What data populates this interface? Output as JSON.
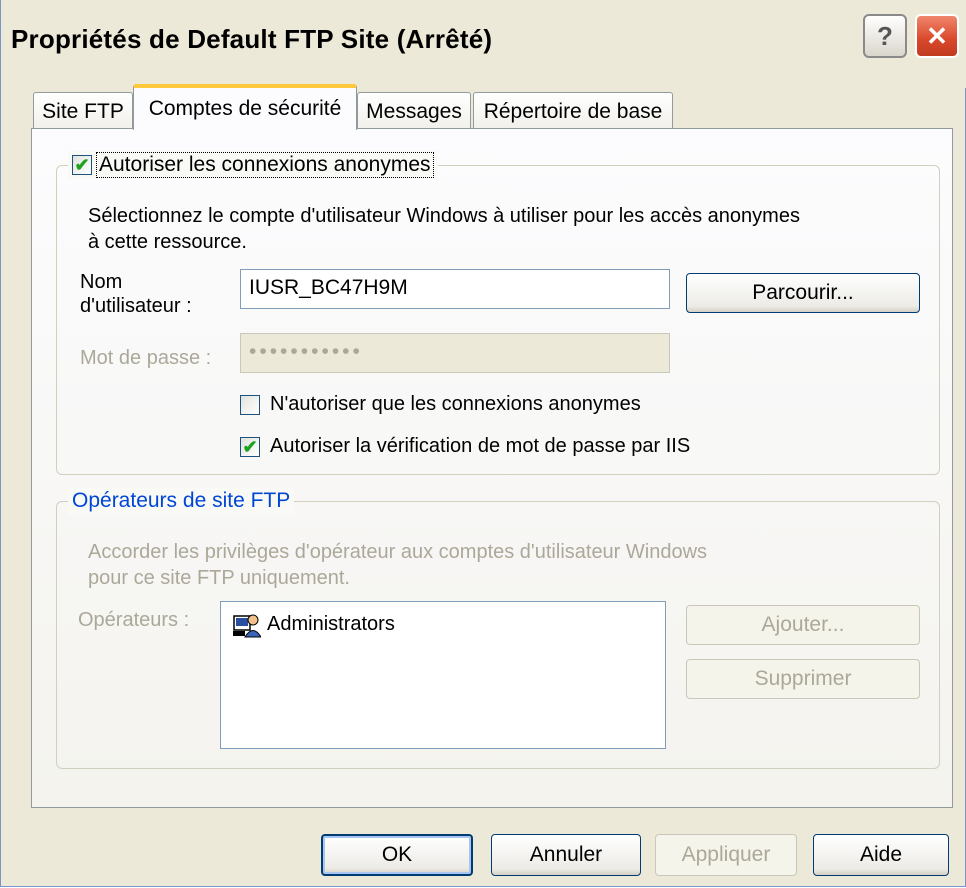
{
  "window": {
    "title": "Propriétés de Default FTP Site (Arrêté)"
  },
  "tabs": [
    {
      "label": "Site FTP"
    },
    {
      "label": "Comptes de sécurité"
    },
    {
      "label": "Messages"
    },
    {
      "label": "Répertoire de base"
    }
  ],
  "anon_group": {
    "checkbox_label": "Autoriser les connexions anonymes",
    "checked": true,
    "description_line1": "Sélectionnez le compte d'utilisateur Windows à utiliser pour les accès anonymes",
    "description_line2": "à cette ressource.",
    "username_label_line1": "Nom",
    "username_label_line2": "d'utilisateur :",
    "username_value": "IUSR_BC47H9M",
    "browse_label": "Parcourir...",
    "password_label": "Mot de passe :",
    "password_value": "•••••••••••",
    "only_anon_label": "N'autoriser que les connexions anonymes",
    "only_anon_checked": false,
    "iis_check_label": "Autoriser la vérification de mot de passe par IIS",
    "iis_check_checked": true
  },
  "operators_group": {
    "legend": "Opérateurs de site FTP",
    "description_line1": "Accorder les privilèges d'opérateur aux comptes d'utilisateur Windows",
    "description_line2": "pour ce site FTP uniquement.",
    "operators_label": "Opérateurs :",
    "operators": [
      "Administrators"
    ],
    "add_label": "Ajouter...",
    "remove_label": "Supprimer"
  },
  "footer": {
    "ok_label": "OK",
    "cancel_label": "Annuler",
    "apply_label": "Appliquer",
    "help_label": "Aide"
  },
  "titlebar_buttons": {
    "help": "?",
    "close": "✕"
  }
}
